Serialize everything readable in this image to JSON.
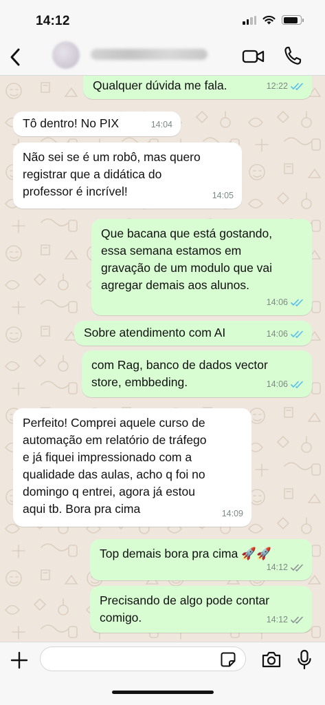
{
  "status_bar": {
    "time": "14:12",
    "battery_level": 0.85,
    "signal_bars_active": 2,
    "icons": [
      "cellular-signal-icon",
      "wifi-icon",
      "battery-icon"
    ]
  },
  "header": {
    "contact_name": "",
    "icons": [
      "back-chevron-icon",
      "avatar",
      "video-camera-icon",
      "phone-icon"
    ]
  },
  "messages": [
    {
      "id": "m1",
      "direction": "out",
      "text": "Qualquer dúvida me fala.",
      "time": "12:22",
      "status": "read"
    },
    {
      "id": "m2",
      "direction": "in",
      "text": "Tô dentro! No PIX",
      "time": "14:04"
    },
    {
      "id": "m3",
      "direction": "in",
      "text": "Não sei se é um robô, mas quero\nregistrar que a didática do\nprofessor é incrível!",
      "time": "14:05"
    },
    {
      "id": "m4",
      "direction": "out",
      "text": "Que bacana que está gostando,\nessa semana estamos em\ngravação de um modulo que vai\nagregar demais aos alunos.",
      "time": "14:06",
      "status": "read"
    },
    {
      "id": "m5",
      "direction": "out",
      "text": "Sobre atendimento com AI",
      "time": "14:06",
      "status": "read"
    },
    {
      "id": "m6",
      "direction": "out",
      "text": "com Rag, banco de dados vector\nstore, embbeding.",
      "time": "14:06",
      "status": "read"
    },
    {
      "id": "m7",
      "direction": "in",
      "text": "Perfeito! Comprei aquele curso de\nautomação em relatório de tráfego\ne já fiquei impressionado com a\nqualidade das aulas, acho q foi no\ndomingo q entrei, agora já estou\naqui tb. Bora pra cima",
      "time": "14:09"
    },
    {
      "id": "m8",
      "direction": "out",
      "text": "Top demais bora pra cima 🚀🚀",
      "time": "14:12",
      "status": "delivered"
    },
    {
      "id": "m9",
      "direction": "out",
      "text": "Precisando de algo pode contar\ncomigo.",
      "time": "14:12",
      "status": "delivered"
    }
  ],
  "composer": {
    "input_value": "",
    "icons": [
      "plus-icon",
      "sticker-icon",
      "camera-icon",
      "microphone-icon"
    ]
  },
  "colors": {
    "outgoing_bubble": "#d9fdd3",
    "incoming_bubble": "#ffffff",
    "chat_background": "#efe7de",
    "read_ticks": "#53bdeb",
    "delivered_ticks": "#8a8f93",
    "bar_background": "#f7f7f7"
  }
}
